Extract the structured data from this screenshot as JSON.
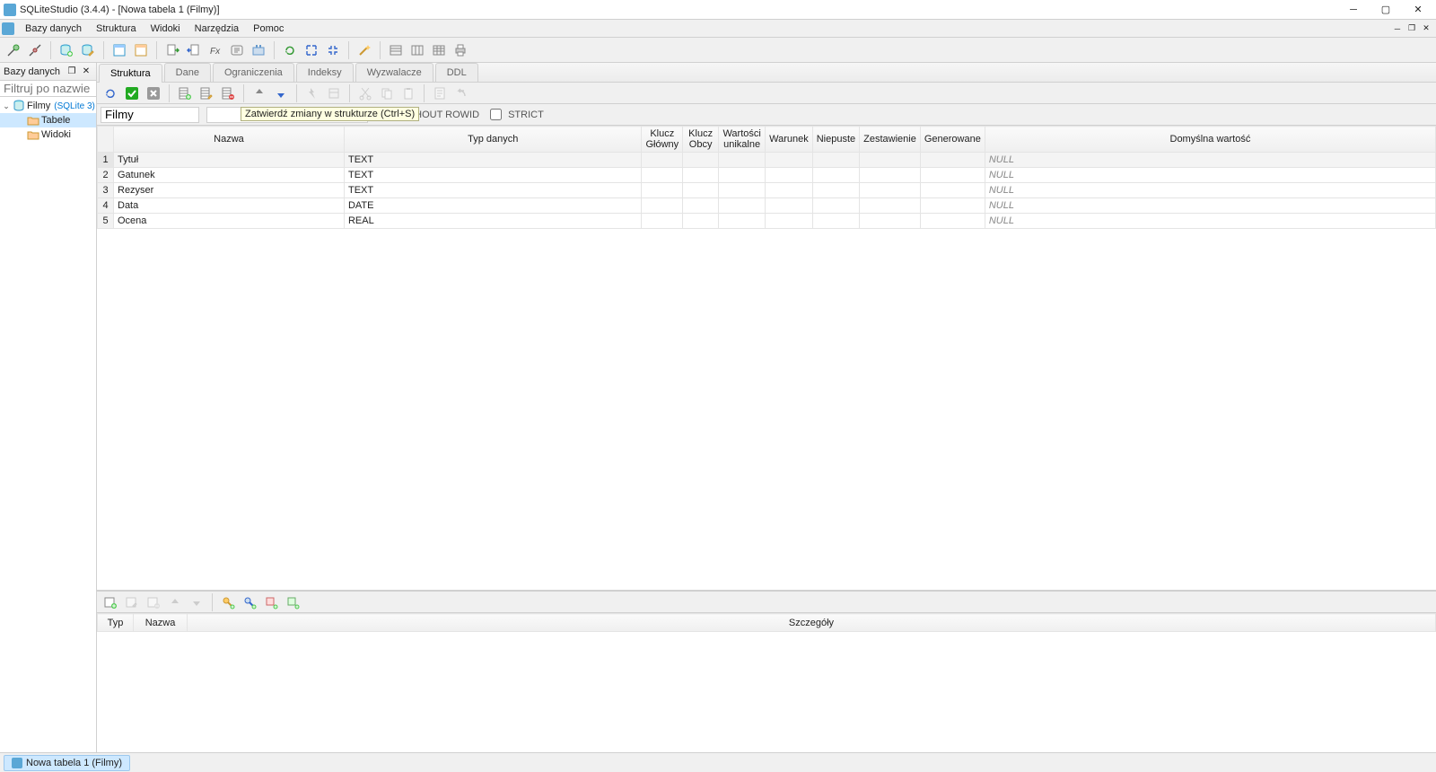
{
  "title": "SQLiteStudio (3.4.4) - [Nowa tabela 1 (Filmy)]",
  "menu": [
    "Bazy danych",
    "Struktura",
    "Widoki",
    "Narzędzia",
    "Pomoc"
  ],
  "sidebar": {
    "title": "Bazy danych",
    "filter_placeholder": "Filtruj po nazwie",
    "db": {
      "name": "Filmy",
      "hint": "(SQLite 3)"
    },
    "nodes": [
      "Tabele",
      "Widoki"
    ]
  },
  "editor": {
    "tabs": [
      "Struktura",
      "Dane",
      "Ograniczenia",
      "Indeksy",
      "Wyzwalacze",
      "DDL"
    ],
    "table_name": "Filmy",
    "tooltip": "Zatwierdź zmiany w strukturze (Ctrl+S)",
    "without_rowid": "WITHOUT ROWID",
    "strict": "STRICT",
    "columns": {
      "headers": [
        "Nazwa",
        "Typ danych",
        "Klucz Główny",
        "Klucz Obcy",
        "Wartości unikalne",
        "Warunek",
        "Niepuste",
        "Zestawienie",
        "Generowane",
        "Domyślna wartość"
      ],
      "rows": [
        {
          "n": "1",
          "name": "Tytuł",
          "type": "TEXT",
          "def": "NULL"
        },
        {
          "n": "2",
          "name": "Gatunek",
          "type": "TEXT",
          "def": "NULL"
        },
        {
          "n": "3",
          "name": "Rezyser",
          "type": "TEXT",
          "def": "NULL"
        },
        {
          "n": "4",
          "name": "Data",
          "type": "DATE",
          "def": "NULL"
        },
        {
          "n": "5",
          "name": "Ocena",
          "type": "REAL",
          "def": "NULL"
        }
      ]
    },
    "constraints_headers": [
      "Typ",
      "Nazwa",
      "Szczegóły"
    ]
  },
  "task_tab": "Nowa tabela 1 (Filmy)"
}
